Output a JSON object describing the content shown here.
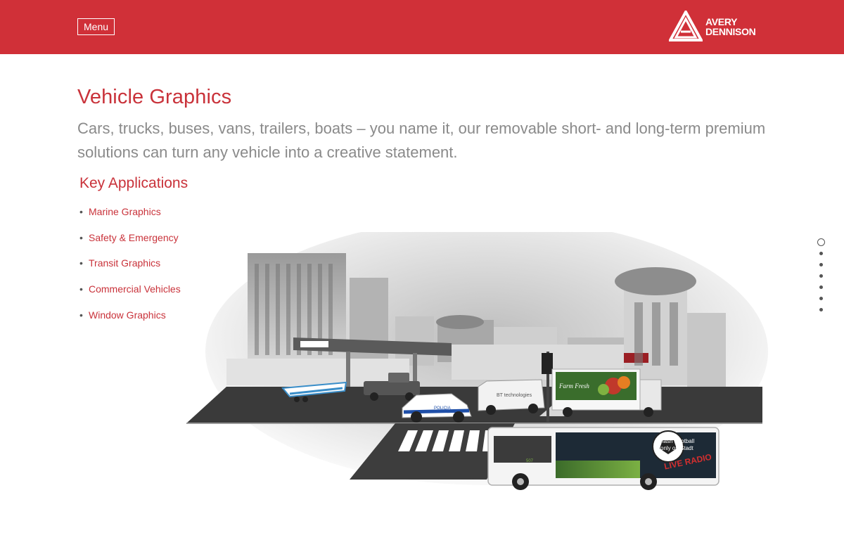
{
  "header": {
    "menu_label": "Menu",
    "logo_line1": "AVERY",
    "logo_line2": "DENNISON",
    "bg_color": "#d03038"
  },
  "main": {
    "title": "Vehicle Graphics",
    "intro": "Cars, trucks, buses, vans, trailers, boats – you name it, our removable short- and long-term premium solutions can turn any vehicle into a creative statement.",
    "applications_heading": "Key Applications",
    "applications": [
      {
        "label": "Marine Graphics"
      },
      {
        "label": "Safety & Emergency"
      },
      {
        "label": "Transit Graphics"
      },
      {
        "label": "Commercial Vehicles"
      },
      {
        "label": "Window Graphics"
      }
    ]
  },
  "illustration": {
    "police_label": "POLICIA",
    "van_label": "BT technologies",
    "truck_label": "Farm Fresh",
    "bus_text_1": "Flash Football",
    "bus_text_2": "only on Stadt",
    "bus_text_3": "LIVE RADIO",
    "bus_number": "507"
  },
  "pager": {
    "count": 7,
    "active_index": 0
  },
  "accent_color": "#c9323a"
}
